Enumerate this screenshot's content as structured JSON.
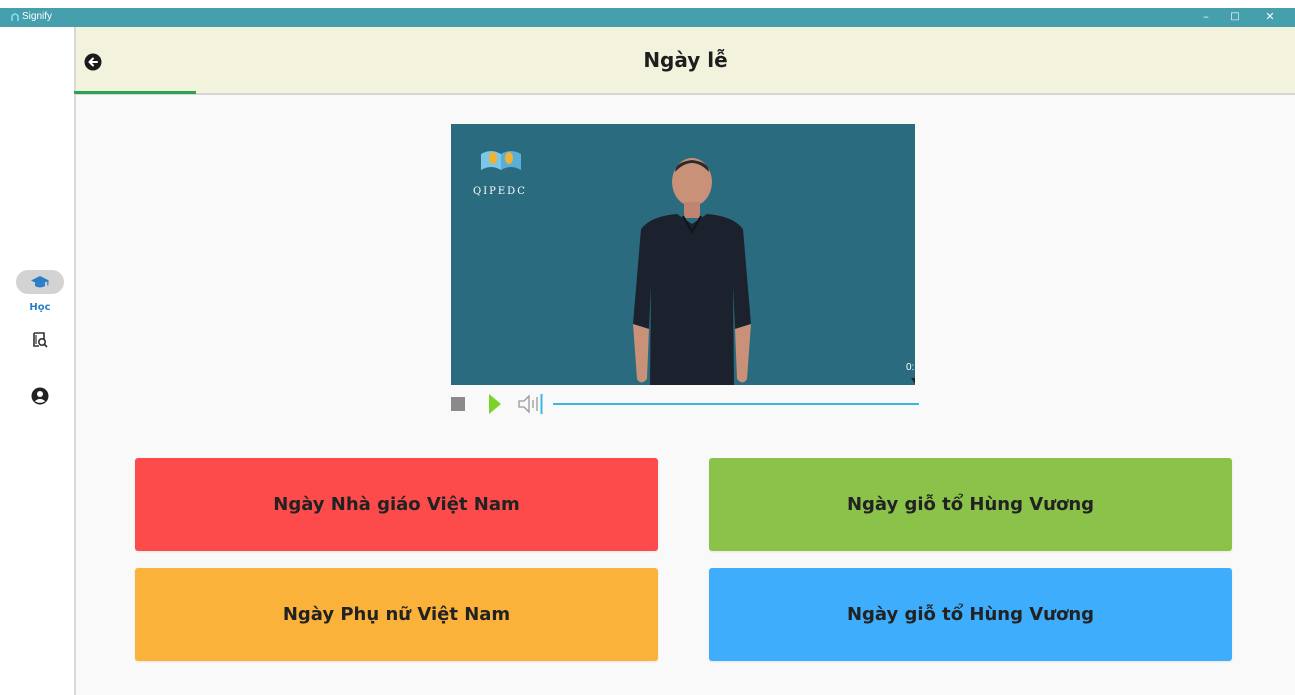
{
  "window": {
    "app_name": "Signify",
    "controls": {
      "minimize": "–",
      "restore": "□",
      "close": "✕"
    }
  },
  "sidebar": {
    "items": [
      {
        "icon": "graduation-cap-icon",
        "label": "Học",
        "active": true
      },
      {
        "icon": "book-search-icon",
        "label": ""
      },
      {
        "icon": "user-circle-icon",
        "label": ""
      }
    ],
    "active_color": "#2a7ec7"
  },
  "header": {
    "title": "Ngày lễ",
    "back_icon": "arrow-left-circle-icon",
    "background": "#f3f2dc",
    "progress": 0.1
  },
  "video": {
    "watermark": "QIPEDC",
    "time": "0:",
    "progress": 1.0
  },
  "answers": [
    {
      "label": "Ngày Nhà giáo Việt Nam",
      "color": "#fd4a4b"
    },
    {
      "label": "Ngày giỗ tổ Hùng Vương",
      "color": "#8bc34a"
    },
    {
      "label": "Ngày Phụ nữ Việt Nam",
      "color": "#fab23a"
    },
    {
      "label": "Ngày giỗ tổ Hùng Vương",
      "color": "#3dadfc"
    }
  ]
}
